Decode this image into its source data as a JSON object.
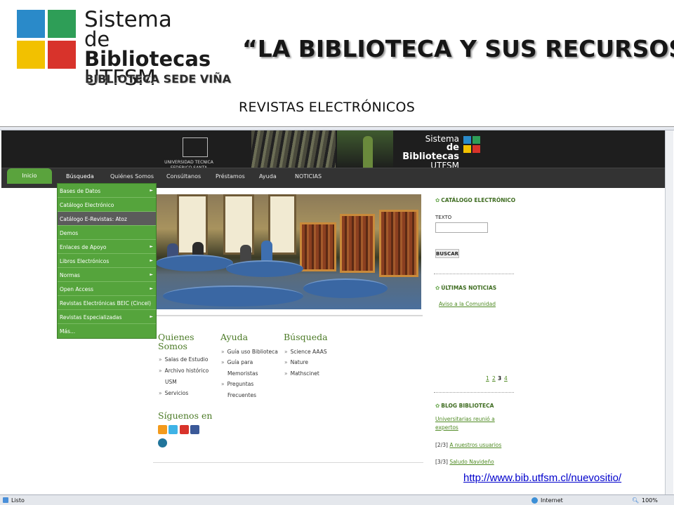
{
  "slide": {
    "logo": {
      "line1": "Sistema",
      "line2_prefix": "de ",
      "line2_bold": "Bibliotecas",
      "line3": "UTFSM"
    },
    "sede": "BIBLIOTECA SEDE VIÑA",
    "title": "“LA BIBLIOTECA Y SUS RECURSOS”",
    "subtitle": "REVISTAS ELECTRÓNICOS",
    "url": "http://www.bib.utfsm.cl/nuevositio/"
  },
  "site": {
    "university": "UNIVERSIDAD TECNICA\nFEDERICO SANTA MARIA",
    "logo": {
      "line1": "Sistema",
      "line2": "de Bibliotecas",
      "line3": "UTFSM"
    },
    "nav": [
      "Inicio",
      "Búsqueda",
      "Quiénes Somos",
      "Consúltanos",
      "Préstamos",
      "Ayuda",
      "NOTICIAS"
    ],
    "dropdown": [
      {
        "label": "Bases de Datos",
        "arrow": true
      },
      {
        "label": "Catálogo Electrónico",
        "arrow": false
      },
      {
        "label": "Catálogo E-Revistas: Atoz",
        "arrow": false,
        "selected": true
      },
      {
        "label": "Demos",
        "arrow": false
      },
      {
        "label": "Enlaces de Apoyo",
        "arrow": true
      },
      {
        "label": "Libros Electrónicos",
        "arrow": true
      },
      {
        "label": "Normas",
        "arrow": true
      },
      {
        "label": "Open Access",
        "arrow": true
      },
      {
        "label": "Revistas Electrónicas BEIC (Cincel)",
        "arrow": false
      },
      {
        "label": "Revistas Especializadas",
        "arrow": true
      },
      {
        "label": "Más...",
        "arrow": false
      }
    ],
    "columns": {
      "quienes": {
        "title": "Quienes Somos",
        "links": [
          "Salas de Estudio",
          "Archivo histórico",
          "USM",
          "Servicios"
        ]
      },
      "ayuda": {
        "title": "Ayuda",
        "links": [
          "Guía uso Biblioteca",
          "Guía para",
          "Memoristas",
          "Preguntas",
          "Frecuentes"
        ]
      },
      "busqueda": {
        "title": "Búsqueda",
        "links": [
          "Science AAAS",
          "Nature",
          "Mathscinet"
        ]
      }
    },
    "siguenos": "Síguenos en",
    "sidebar": {
      "catalogo": "CATÁLOGO ELECTRÓNICO",
      "texto_label": "TEXTO",
      "buscar": "BUSCAR",
      "noticias": "ÚLTIMAS NOTICIAS",
      "aviso": "Aviso a la Comunidad",
      "pages": [
        "1",
        "2",
        "3",
        "4"
      ],
      "blog": "BLOG BIBLIOTECA",
      "blog1a": "Universitarias reunió a",
      "blog1b": "expertos",
      "blog2_prefix": "[2/3] ",
      "blog2": "A nuestros usuarios",
      "blog3_prefix": "[3/3] ",
      "blog3": "Saludo Navideño"
    }
  },
  "statusbar": {
    "status": "Listo",
    "zone": "Internet",
    "zoom": "100%"
  },
  "icons": [
    "rss-icon",
    "twitter-icon",
    "youtube-icon",
    "facebook-icon",
    "wordpress-icon"
  ]
}
